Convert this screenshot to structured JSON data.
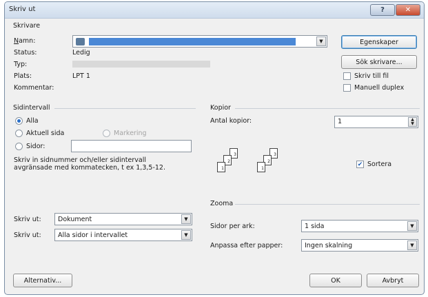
{
  "window": {
    "title": "Skriv ut",
    "help_label": "?",
    "close_label": "✕"
  },
  "printer": {
    "group_label": "Skrivare",
    "name_label": "Namn:",
    "name_value": "",
    "status_label": "Status:",
    "status_value": "Ledig",
    "type_label": "Typ:",
    "type_value": "",
    "location_label": "Plats:",
    "location_value": "LPT 1",
    "comment_label": "Kommentar:",
    "properties_button": "Egenskaper",
    "find_printer_button": "Sök skrivare...",
    "print_to_file_label": "Skriv till fil",
    "print_to_file_checked": false,
    "manual_duplex_label": "Manuell duplex",
    "manual_duplex_checked": false
  },
  "page_range": {
    "group_label": "Sidintervall",
    "all_label": "Alla",
    "current_page_label": "Aktuell sida",
    "selection_label": "Markering",
    "pages_label": "Sidor:",
    "pages_value": "",
    "hint_line1": "Skriv in sidnummer och/eller sidintervall",
    "hint_line2": "avgränsade med kommatecken, t ex 1,3,5-12.",
    "selected": "all"
  },
  "copies": {
    "group_label": "Kopior",
    "count_label": "Antal kopior:",
    "count_value": "1",
    "collate_label": "Sortera",
    "collate_checked": true,
    "page_numbers": [
      "1",
      "2",
      "3"
    ]
  },
  "print_what": {
    "label": "Skriv ut:",
    "value": "Dokument"
  },
  "print_range": {
    "label": "Skriv ut:",
    "value": "Alla sidor i intervallet"
  },
  "zoom": {
    "group_label": "Zooma",
    "pages_per_sheet_label": "Sidor per ark:",
    "pages_per_sheet_value": "1 sida",
    "scale_label": "Anpassa efter papper:",
    "scale_value": "Ingen skalning"
  },
  "footer": {
    "options_button": "Alternativ...",
    "ok_button": "OK",
    "cancel_button": "Avbryt"
  }
}
